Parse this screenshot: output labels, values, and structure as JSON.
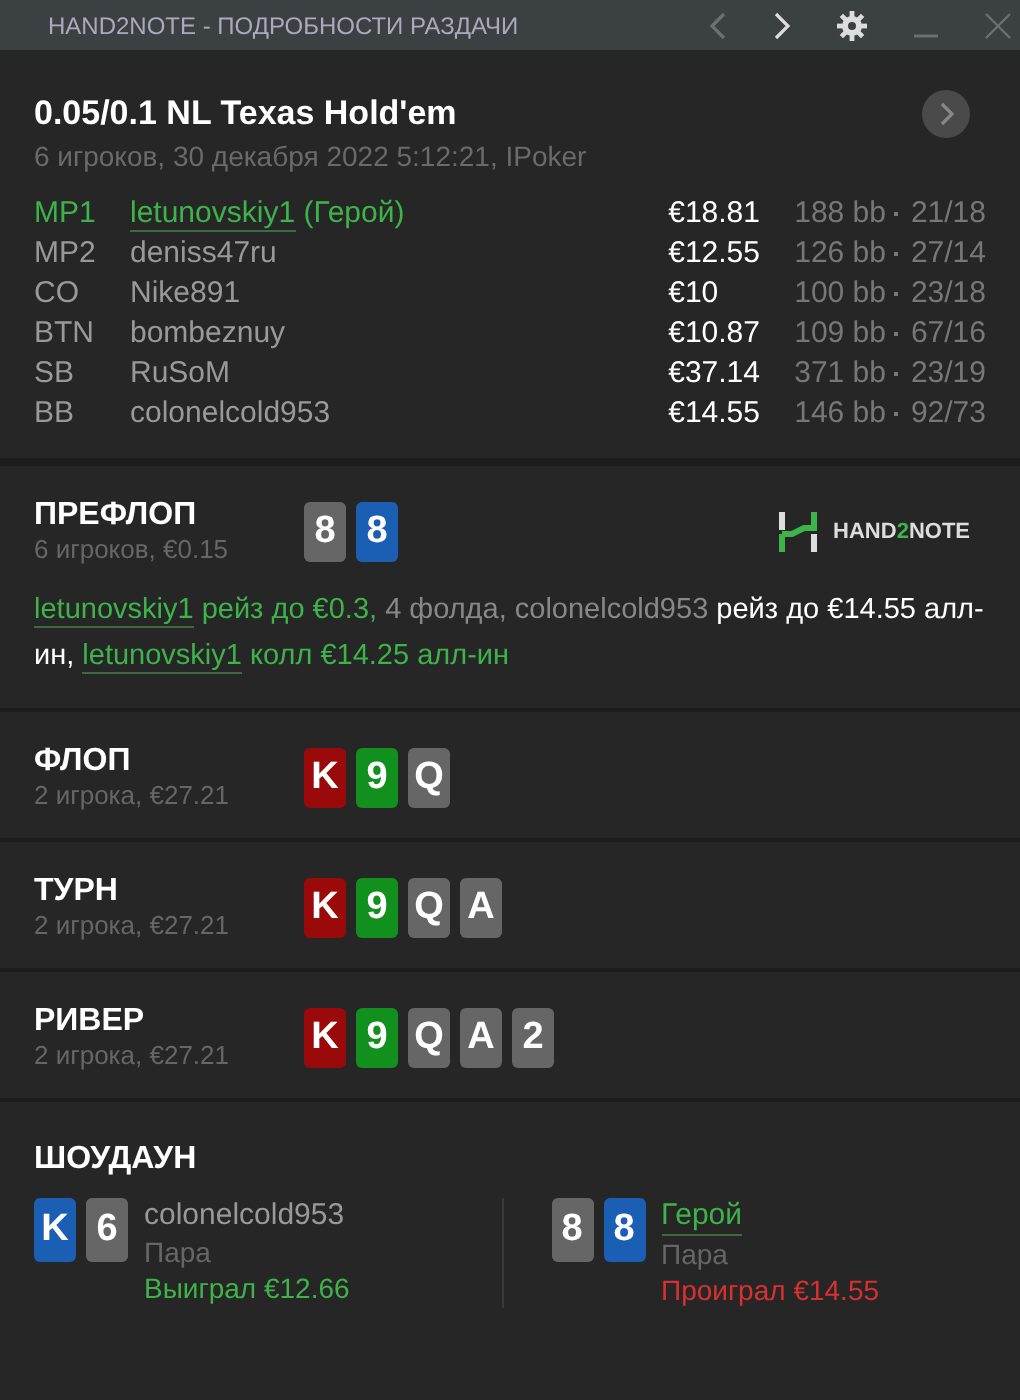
{
  "window": {
    "title": "HAND2NOTE - ПОДРОБНОСТИ РАЗДАЧИ",
    "prev_disabled": true
  },
  "hand": {
    "title": "0.05/0.1 NL Texas Hold'em",
    "subtitle": "6 игроков, 30 декабря 2022 5:12:21, IPoker"
  },
  "players": [
    {
      "position": "MP1",
      "name": "letunovskiy1",
      "tag": "(Герой)",
      "hero": true,
      "stack": "€18.81",
      "bb": "188 bb",
      "stats": "21/18"
    },
    {
      "position": "MP2",
      "name": "deniss47ru",
      "hero": false,
      "stack": "€12.55",
      "bb": "126 bb",
      "stats": "27/14"
    },
    {
      "position": "CO",
      "name": "Nike891",
      "hero": false,
      "stack": "€10",
      "bb": "100 bb",
      "stats": "23/18"
    },
    {
      "position": "BTN",
      "name": "bombeznuy",
      "hero": false,
      "stack": "€10.87",
      "bb": "109 bb",
      "stats": "67/16"
    },
    {
      "position": "SB",
      "name": "RuSoM",
      "hero": false,
      "stack": "€37.14",
      "bb": "371 bb",
      "stats": "23/19"
    },
    {
      "position": "BB",
      "name": "colonelcold953",
      "hero": false,
      "stack": "€14.55",
      "bb": "146 bb",
      "stats": "92/73"
    }
  ],
  "logo": {
    "text_a": "HAND",
    "text_b": "2",
    "text_c": "NOTE"
  },
  "streets": [
    {
      "name": "ПРЕФЛОП",
      "info": "6 игроков, €0.15",
      "cards": [
        {
          "rank": "8",
          "color": "#666666"
        },
        {
          "rank": "8",
          "color": "#1a5fb4"
        }
      ],
      "action": [
        {
          "text": "letunovskiy1",
          "kind": "hero-link"
        },
        {
          "text": " рейз до €0.3,",
          "kind": "hero"
        },
        {
          "text": " 4 фолда, colonelcold953",
          "kind": "muted"
        },
        {
          "text": " рейз до €14.55 алл-ин, ",
          "kind": "plain"
        },
        {
          "text": "letunovskiy1",
          "kind": "hero-link"
        },
        {
          "text": " колл €14.25 алл-ин",
          "kind": "hero"
        }
      ]
    },
    {
      "name": "ФЛОП",
      "info": "2 игрока, €27.21",
      "cards": [
        {
          "rank": "K",
          "color": "#9b0a0a"
        },
        {
          "rank": "9",
          "color": "#12901e"
        },
        {
          "rank": "Q",
          "color": "#666666"
        }
      ]
    },
    {
      "name": "ТУРН",
      "info": "2 игрока, €27.21",
      "cards": [
        {
          "rank": "K",
          "color": "#9b0a0a"
        },
        {
          "rank": "9",
          "color": "#12901e"
        },
        {
          "rank": "Q",
          "color": "#666666"
        },
        {
          "rank": "A",
          "color": "#666666"
        }
      ]
    },
    {
      "name": "РИВЕР",
      "info": "2 игрока, €27.21",
      "cards": [
        {
          "rank": "K",
          "color": "#9b0a0a"
        },
        {
          "rank": "9",
          "color": "#12901e"
        },
        {
          "rank": "Q",
          "color": "#666666"
        },
        {
          "rank": "A",
          "color": "#666666"
        },
        {
          "rank": "2",
          "color": "#666666"
        }
      ]
    }
  ],
  "showdown": {
    "title": "ШОУДАУН",
    "hands": [
      {
        "cards": [
          {
            "rank": "K",
            "color": "#1a5fb4"
          },
          {
            "rank": "6",
            "color": "#666666"
          }
        ],
        "name": "colonelcold953",
        "hero": false,
        "combo": "Пара",
        "result": "Выиграл €12.66",
        "kind": "won"
      },
      {
        "cards": [
          {
            "rank": "8",
            "color": "#666666"
          },
          {
            "rank": "8",
            "color": "#1a5fb4"
          }
        ],
        "name": "Герой",
        "hero": true,
        "combo": "Пара",
        "result": "Проиграл €14.55",
        "kind": "lost"
      }
    ]
  }
}
